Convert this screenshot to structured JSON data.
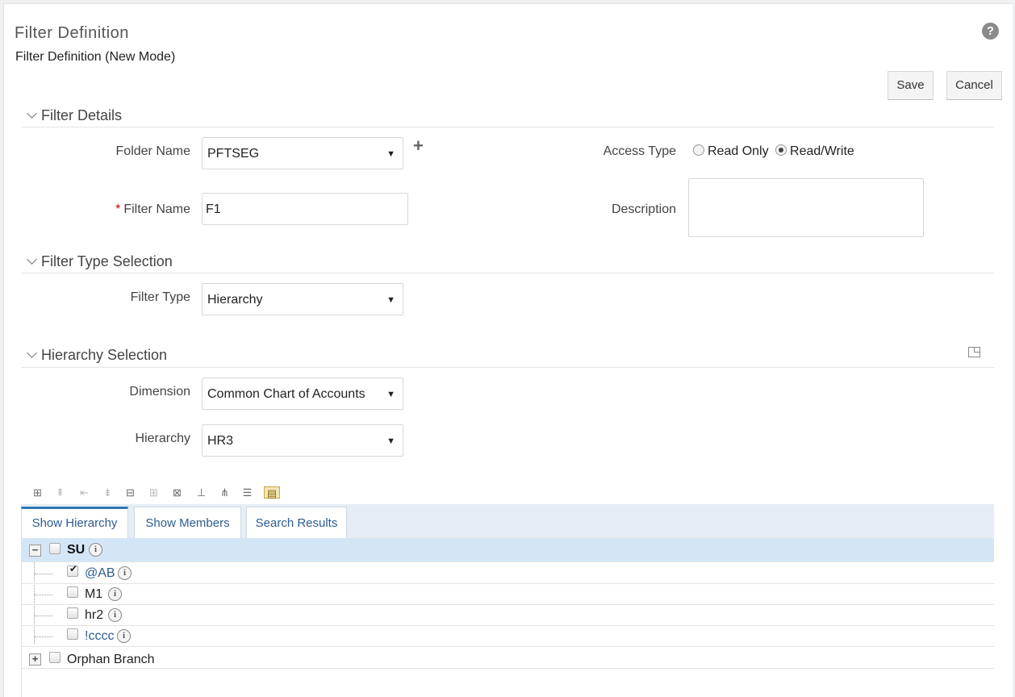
{
  "header": {
    "title": "Filter Definition",
    "subtitle": "Filter Definition (New Mode)"
  },
  "actions": {
    "save": "Save",
    "cancel": "Cancel"
  },
  "filter_details": {
    "heading": "Filter Details",
    "folder_label": "Folder Name",
    "folder_value": "PFTSEG",
    "filter_name_label": "Filter Name",
    "filter_name_value": "F1",
    "access_label": "Access Type",
    "access_options": [
      "Read Only",
      "Read/Write"
    ],
    "access_selected": "Read/Write",
    "description_label": "Description",
    "description_value": ""
  },
  "filter_type": {
    "heading": "Filter Type Selection",
    "label": "Filter Type",
    "value": "Hierarchy"
  },
  "hierarchy_selection": {
    "heading": "Hierarchy Selection",
    "dimension_label": "Dimension",
    "dimension_value": "Common Chart of Accounts",
    "hierarchy_label": "Hierarchy",
    "hierarchy_value": "HR3"
  },
  "tabs": [
    "Show Hierarchy",
    "Show Members",
    "Search Results"
  ],
  "active_tab": "Show Hierarchy",
  "tree": {
    "root": {
      "label": "SU",
      "expanded": true,
      "checked": false
    },
    "children": [
      {
        "label": "@AB",
        "checked": true,
        "link": true
      },
      {
        "label": "M1",
        "checked": false,
        "link": false
      },
      {
        "label": "hr2",
        "checked": false,
        "link": false
      },
      {
        "label": "!cccc",
        "checked": false,
        "link": true
      }
    ],
    "orphan": {
      "label": "Orphan Branch",
      "expanded": false,
      "checked": false
    }
  },
  "colors": {
    "link": "#2c5d8f",
    "active_tab": "#2d76b8",
    "selected_row": "#d4e6f6",
    "tabstrip_bg": "#e6edf4"
  },
  "icons": {
    "help": "?",
    "add_folder": "+",
    "info": "i"
  }
}
